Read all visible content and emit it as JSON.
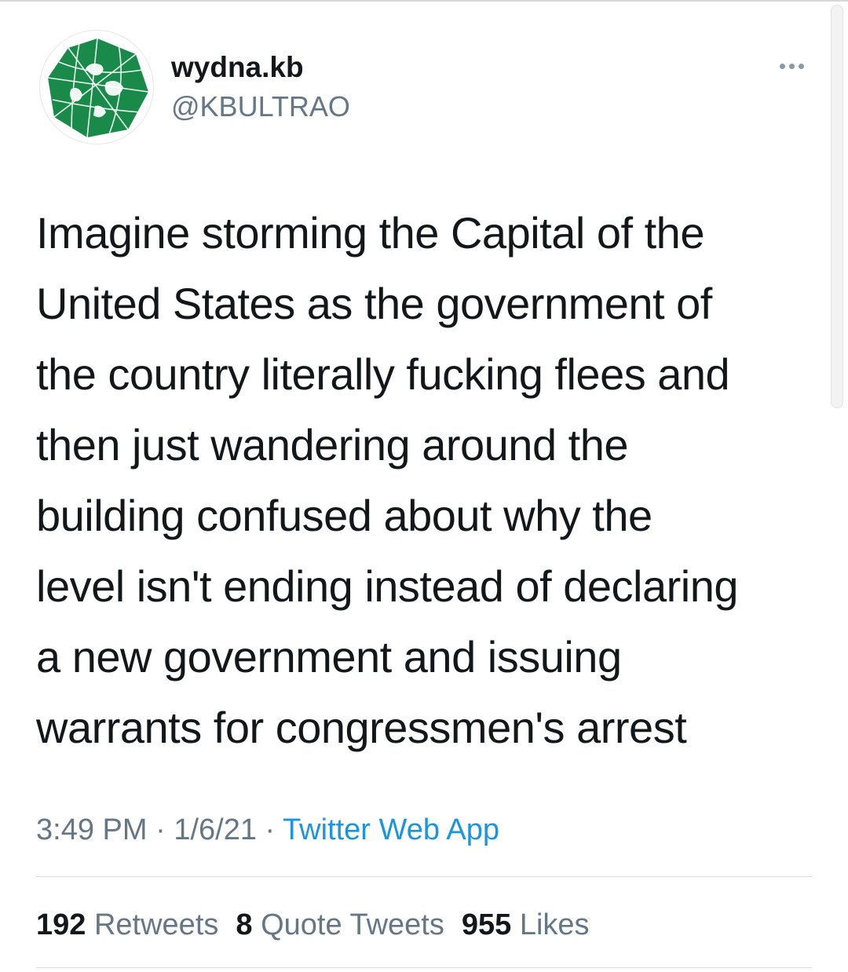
{
  "user": {
    "display_name": "wydna.kb",
    "handle": "@KBULTRAO",
    "avatar_icon": "globe-map-avatar-icon",
    "avatar_color": "#1a8a4a"
  },
  "more_icon": "ellipsis-icon",
  "tweet": {
    "text": "Imagine storming the Capital of the\nUnited States as the government of\nthe country literally fucking flees and\nthen just wandering around the\nbuilding confused about why the\nlevel isn't ending instead of declaring\na new government and issuing\nwarrants for congressmen's arrest"
  },
  "meta": {
    "time": "3:49 PM",
    "separator": "·",
    "date": "1/6/21",
    "source": "Twitter Web App"
  },
  "stats": {
    "retweets_count": "192",
    "retweets_label": "Retweets",
    "quotes_count": "8",
    "quotes_label": "Quote Tweets",
    "likes_count": "955",
    "likes_label": "Likes"
  },
  "colors": {
    "text": "#14171a",
    "secondary": "#657786",
    "link": "#1b95e0"
  }
}
